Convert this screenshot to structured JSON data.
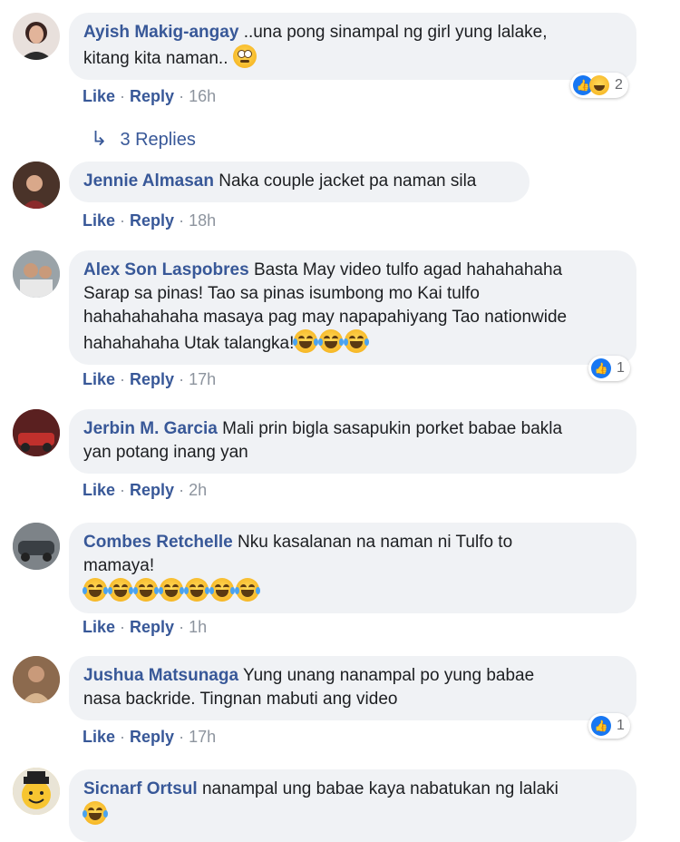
{
  "comments": [
    {
      "author": "Ayish Makig-angay",
      "text1": "..una pong sinampal ng girl yung lalake,",
      "text2": "kitang kita naman..",
      "like": "Like",
      "reply": "Reply",
      "time": "16h",
      "reaction_count": "2",
      "replies_label": "3 Replies"
    },
    {
      "author": "Jennie Almasan",
      "text1": "Naka couple jacket pa naman sila",
      "like": "Like",
      "reply": "Reply",
      "time": "18h"
    },
    {
      "author": "Alex Son Laspobres",
      "text1": "Basta May video tulfo agad hahahahaha",
      "text2": "Sarap sa pinas! Tao sa pinas isumbong mo Kai tulfo",
      "text3": "hahahahahaha masaya pag may napapahiyang Tao nationwide",
      "text4": "hahahahaha Utak talangka!",
      "like": "Like",
      "reply": "Reply",
      "time": "17h",
      "reaction_count": "1"
    },
    {
      "author": "Jerbin M. Garcia",
      "text1": "Mali prin bigla sasapukin porket babae bakla",
      "text2": "yan potang inang yan",
      "like": "Like",
      "reply": "Reply",
      "time": "2h"
    },
    {
      "author": "Combes Retchelle",
      "text1": "Nku kasalanan na naman ni Tulfo to",
      "text2": "mamaya!",
      "like": "Like",
      "reply": "Reply",
      "time": "1h"
    },
    {
      "author": "Jushua Matsunaga",
      "text1": "Yung unang nanampal po yung babae",
      "text2": "nasa backride. Tingnan mabuti ang video",
      "like": "Like",
      "reply": "Reply",
      "time": "17h",
      "reaction_count": "1"
    },
    {
      "author": "Sicnarf Ortsul",
      "text1": "nanampal ung babae kaya nabatukan ng lalaki"
    }
  ],
  "colors": {
    "author": "#385898",
    "bubble": "#f0f2f5",
    "meta": "#8d949e",
    "like_blue": "#1877f2"
  }
}
